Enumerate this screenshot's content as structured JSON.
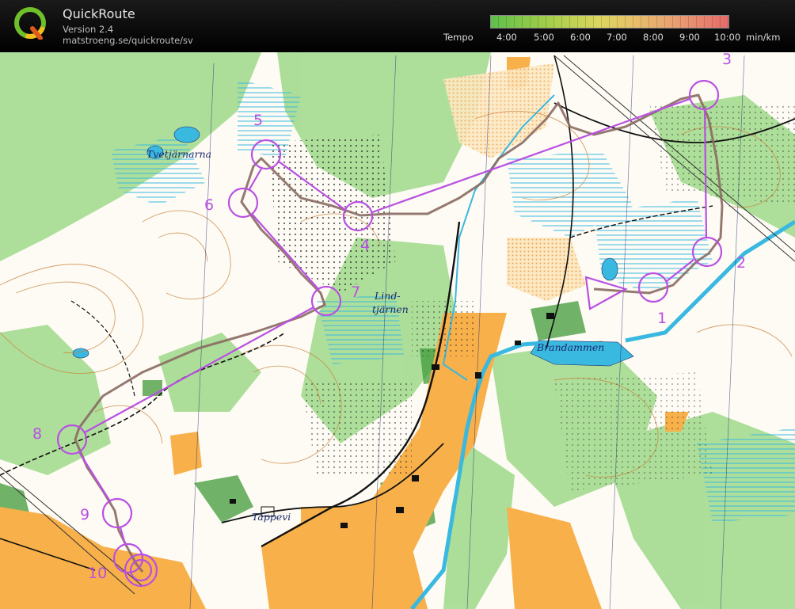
{
  "app": {
    "title": "QuickRoute",
    "version": "Version 2.4",
    "url": "matstroeng.se/quickroute/sv"
  },
  "tempo": {
    "label": "Tempo",
    "ticks": [
      "4:00",
      "5:00",
      "6:00",
      "7:00",
      "8:00",
      "9:00",
      "10:00"
    ],
    "unit": "min/km"
  },
  "map": {
    "place_names": {
      "tvetjarnarna": "Tvetjärnarna",
      "lindtjarnen_1": "Lind-",
      "lindtjarnen_2": "tjärnen",
      "brandammen": "Brandammen",
      "tappevi": "Täppevi"
    },
    "controls": [
      "1",
      "2",
      "3",
      "4",
      "5",
      "6",
      "7",
      "8",
      "9",
      "10"
    ],
    "colors": {
      "course": "#b94fe3",
      "route": "#8a6a63",
      "water": "#39b8e0",
      "forest": "#9fd98a",
      "open_land": "#f7b04a",
      "contour": "#c8803a"
    }
  }
}
